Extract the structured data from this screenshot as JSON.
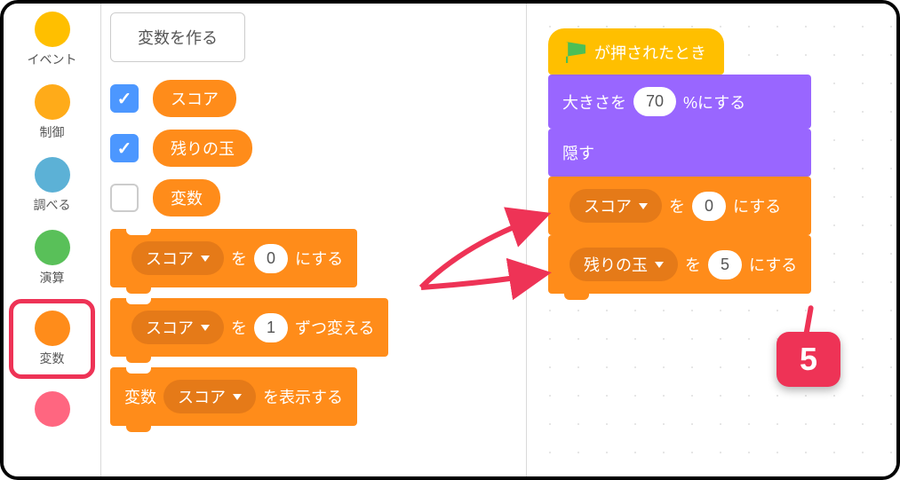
{
  "sidebar": {
    "categories": [
      {
        "key": "events",
        "label": "イベント"
      },
      {
        "key": "control",
        "label": "制御"
      },
      {
        "key": "sensing",
        "label": "調べる"
      },
      {
        "key": "operators",
        "label": "演算"
      },
      {
        "key": "variables",
        "label": "変数"
      },
      {
        "key": "myblocks",
        "label": ""
      }
    ]
  },
  "palette": {
    "make_variable": "変数を作る",
    "vars": [
      {
        "name": "スコア",
        "checked": true
      },
      {
        "name": "残りの玉",
        "checked": true
      },
      {
        "name": "変数",
        "checked": false
      }
    ],
    "blocks": {
      "set": {
        "var": "スコア",
        "mid": "を",
        "val": "0",
        "suf": "にする"
      },
      "change": {
        "var": "スコア",
        "mid": "を",
        "val": "1",
        "suf": "ずつ変える"
      },
      "show": {
        "pre": "変数",
        "var": "スコア",
        "suf": "を表示する"
      }
    }
  },
  "script": {
    "hat": "が押されたとき",
    "setsize": {
      "pre": "大きさを",
      "val": "70",
      "suf": "%にする"
    },
    "hide": "隠す",
    "set1": {
      "var": "スコア",
      "mid": "を",
      "val": "0",
      "suf": "にする"
    },
    "set2": {
      "var": "残りの玉",
      "mid": "を",
      "val": "5",
      "suf": "にする"
    }
  },
  "callout": {
    "text": "5"
  }
}
